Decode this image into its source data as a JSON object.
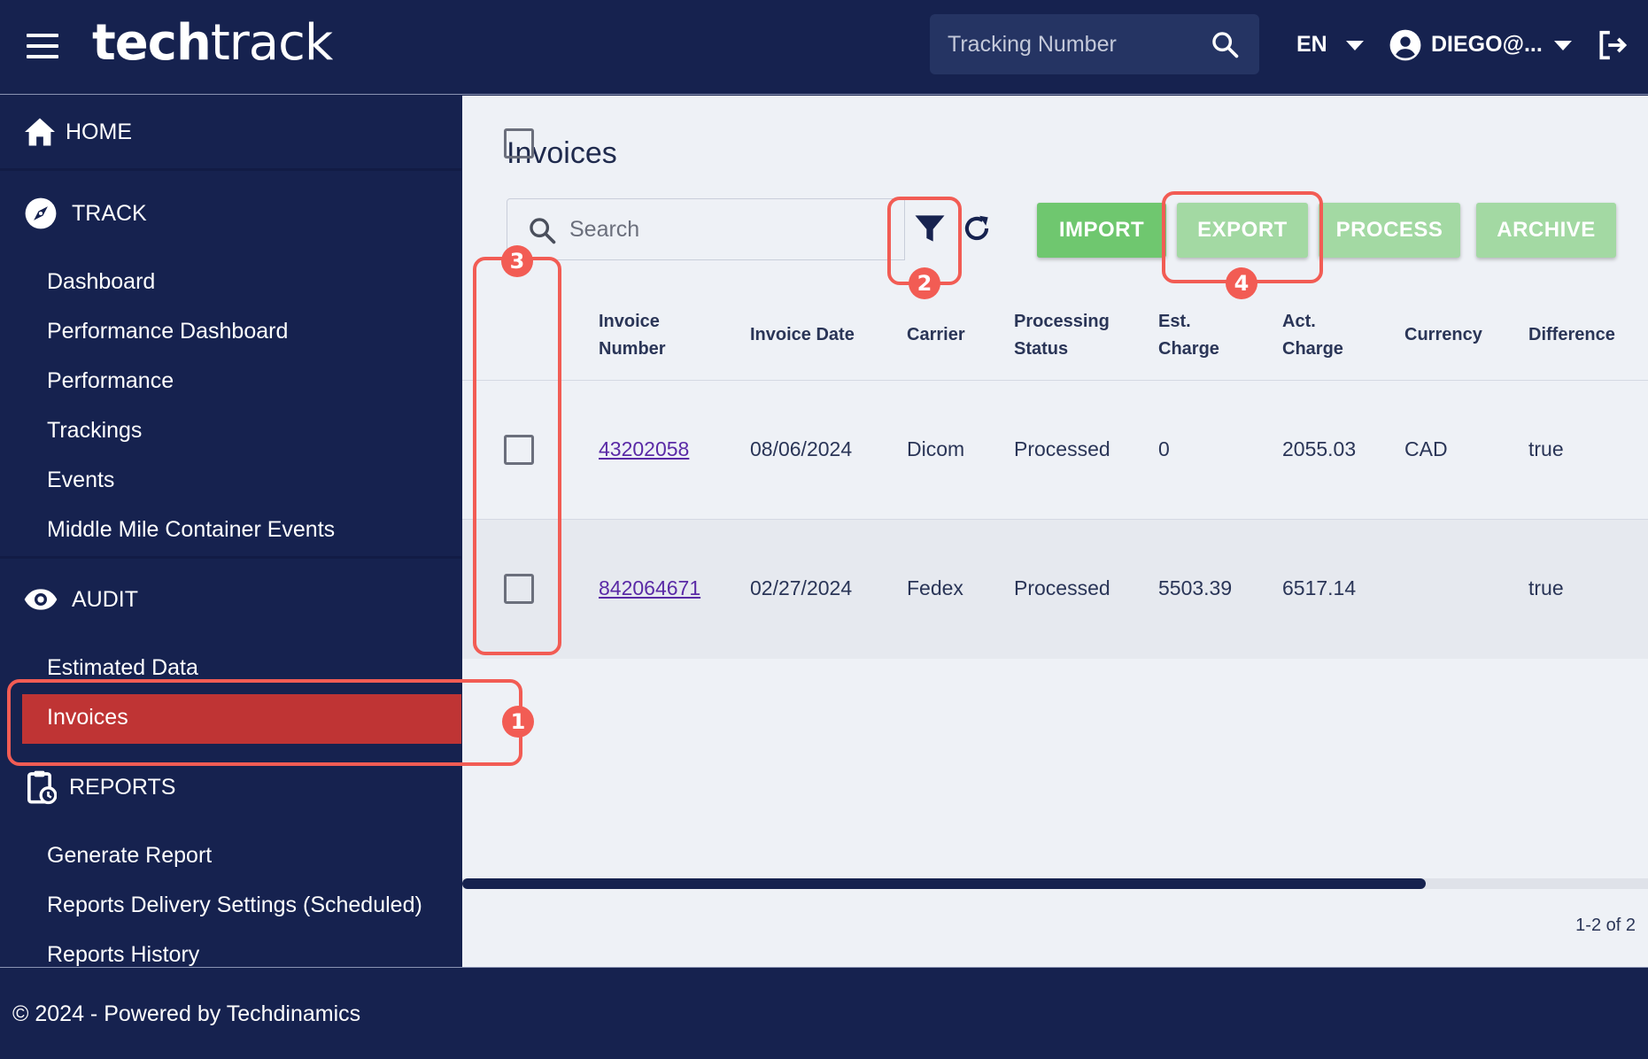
{
  "header": {
    "logo_bold": "tech",
    "logo_light": "track",
    "tracking_placeholder": "Tracking Number",
    "language": "EN",
    "user": "DIEGO@..."
  },
  "sidebar": {
    "home": "HOME",
    "track": {
      "label": "TRACK",
      "items": [
        "Dashboard",
        "Performance Dashboard",
        "Performance",
        "Trackings",
        "Events",
        "Middle Mile Container Events"
      ]
    },
    "audit": {
      "label": "AUDIT",
      "items": [
        "Estimated Data",
        "Invoices"
      ],
      "active": "Invoices"
    },
    "reports": {
      "label": "REPORTS",
      "items": [
        "Generate Report",
        "Reports Delivery Settings (Scheduled)",
        "Reports History"
      ]
    }
  },
  "main": {
    "title": "Invoices",
    "search_placeholder": "Search",
    "buttons": {
      "import": "IMPORT",
      "export": "EXPORT",
      "process": "PROCESS",
      "archive": "ARCHIVE"
    },
    "columns": {
      "invoice_number": [
        "Invoice",
        "Number"
      ],
      "invoice_date": "Invoice Date",
      "carrier": "Carrier",
      "processing_status": [
        "Processing",
        "Status"
      ],
      "est_charge": [
        "Est.",
        "Charge"
      ],
      "act_charge": [
        "Act.",
        "Charge"
      ],
      "currency": "Currency",
      "difference": "Difference"
    },
    "rows": [
      {
        "invoice_number": "43202058",
        "invoice_date": "08/06/2024",
        "carrier": "Dicom",
        "status": "Processed",
        "est_charge": "0",
        "act_charge": "2055.03",
        "currency": "CAD",
        "difference": "true"
      },
      {
        "invoice_number": "842064671",
        "invoice_date": "02/27/2024",
        "carrier": "Fedex",
        "status": "Processed",
        "est_charge": "5503.39",
        "act_charge": "6517.14",
        "currency": "",
        "difference": "true"
      }
    ],
    "pagination": "1-2 of 2"
  },
  "footer": {
    "text": "© 2024 - Powered by Techdinamics"
  },
  "annotations": [
    "1",
    "2",
    "3",
    "4"
  ],
  "colors": {
    "navy": "#16224f",
    "active_red": "#bf3434",
    "import_green": "#6fc76f",
    "disabled_green": "#a3d9a3",
    "highlight": "#f25c54"
  }
}
